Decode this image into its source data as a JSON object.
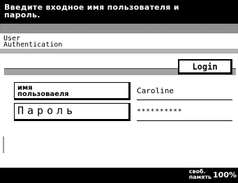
{
  "message": {
    "line1": "Введите входное имя пользователя и",
    "line2": "пароль."
  },
  "screen": {
    "title_line1": "User",
    "title_line2": "Authentication",
    "login_label": "Login"
  },
  "fields": {
    "username_label_line1": "имя",
    "username_label_line2": "пользоваеля",
    "username_value": "Caroline",
    "password_label": "Пароль",
    "password_value": "**********"
  },
  "status": {
    "memory_label_line1": "своб.",
    "memory_label_line2": "память",
    "memory_value": "100%"
  }
}
